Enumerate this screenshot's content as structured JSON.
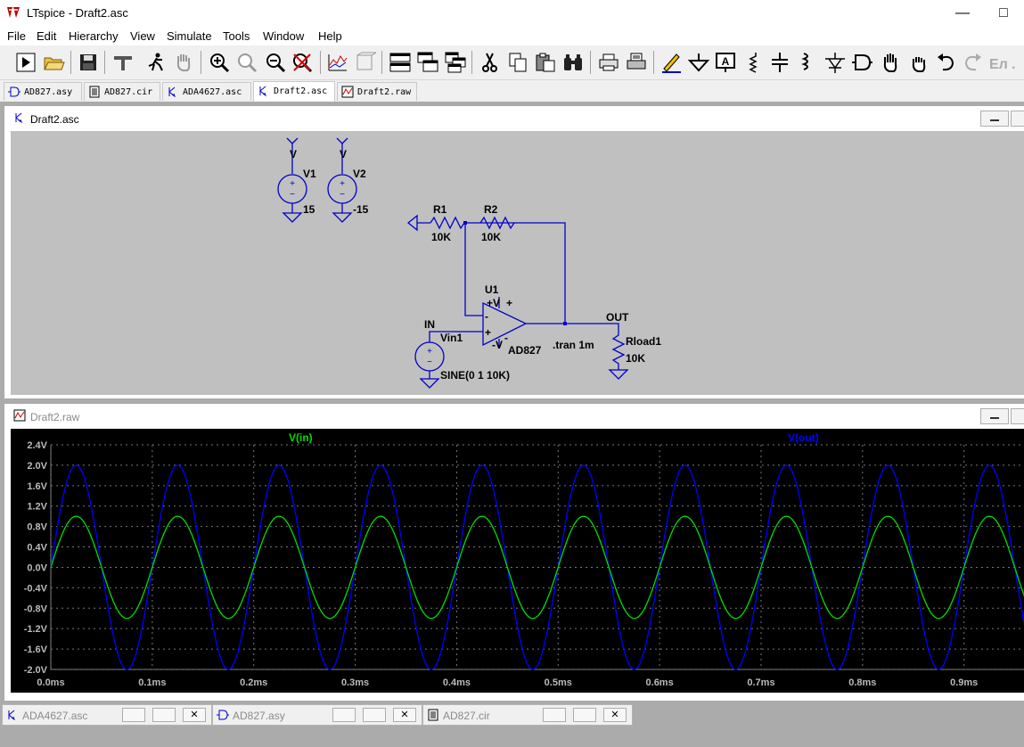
{
  "window": {
    "title": "LTspice - Draft2.asc"
  },
  "menu": [
    "File",
    "Edit",
    "Hierarchy",
    "View",
    "Simulate",
    "Tools",
    "Window",
    "Help"
  ],
  "toolbar_icons": [
    "run-icon",
    "open-icon",
    "save-icon",
    "control-panel-icon",
    "halt-icon",
    "pan-icon",
    "zoom-in-icon",
    "zoom-fit-icon",
    "zoom-out-icon",
    "zoom-cancel-icon",
    "autoscale-icon",
    "window-icon",
    "tile-horizontal-icon",
    "cascade-icon",
    "tile-vertical-icon",
    "cut-icon",
    "copy-icon",
    "paste-icon",
    "find-icon",
    "print-setup-icon",
    "print-icon",
    "wire-icon",
    "ground-icon",
    "label-icon",
    "resistor-icon",
    "capacitor-icon",
    "inductor-icon",
    "diode-icon",
    "component-icon",
    "move-icon",
    "drag-icon",
    "undo-icon",
    "redo-icon",
    "text-icon",
    "spice-directive-icon"
  ],
  "doc_tabs": [
    {
      "label": "AD827.asy",
      "icon": "opamp-symbol-icon"
    },
    {
      "label": "AD827.cir",
      "icon": "netlist-icon"
    },
    {
      "label": "ADA4627.asc",
      "icon": "schematic-icon"
    },
    {
      "label": "Draft2.asc",
      "icon": "schematic-icon"
    },
    {
      "label": "Draft2.raw",
      "icon": "waveform-icon"
    }
  ],
  "schematic_window": {
    "title": "Draft2.asc",
    "labels": {
      "v1_net": "V",
      "v1_name": "V1",
      "v1_value": "15",
      "v2_net": "V",
      "v2_name": "V2",
      "v2_value": "-15",
      "r1_name": "R1",
      "r1_value": "10K",
      "r2_name": "R2",
      "r2_value": "10K",
      "u1_name": "U1",
      "u1_vplus": "+V",
      "u1_plus": "+",
      "u1_inv": "-",
      "u1_noninv": "+",
      "u1_vminus": "-V",
      "u1_vminus_sign": "-",
      "u1_part": "AD827",
      "in_net": "IN",
      "vin_name": "Vin1",
      "vin_value": "SINE(0 1 10K)",
      "out_net": "OUT",
      "rload_name": "Rload1",
      "rload_value": "10K",
      "directive": ".tran 1m"
    }
  },
  "plot_window": {
    "title": "Draft2.raw"
  },
  "chart_data": {
    "type": "line",
    "series": [
      {
        "name": "V(in)",
        "color": "#00dd00",
        "amplitude": 1.0,
        "frequency_hz": 10000,
        "phase": 0
      },
      {
        "name": "V(out)",
        "color": "#0000ff",
        "amplitude": 2.0,
        "frequency_hz": 10000,
        "phase": 0
      }
    ],
    "x_ticks": [
      "0.0ms",
      "0.1ms",
      "0.2ms",
      "0.3ms",
      "0.4ms",
      "0.5ms",
      "0.6ms",
      "0.7ms",
      "0.8ms",
      "0.9ms"
    ],
    "y_ticks": [
      "2.4V",
      "2.0V",
      "1.6V",
      "1.2V",
      "0.8V",
      "0.4V",
      "0.0V",
      "-0.4V",
      "-0.8V",
      "-1.2V",
      "-1.6V",
      "-2.0V"
    ],
    "xlim_ms": [
      0,
      0.96
    ],
    "ylim": [
      -2.0,
      2.4
    ],
    "grid": true
  },
  "minimized_windows": [
    {
      "label": "ADA4627.asc",
      "icon": "schematic-icon"
    },
    {
      "label": "AD827.asy",
      "icon": "opamp-symbol-icon"
    },
    {
      "label": "AD827.cir",
      "icon": "netlist-icon"
    }
  ]
}
